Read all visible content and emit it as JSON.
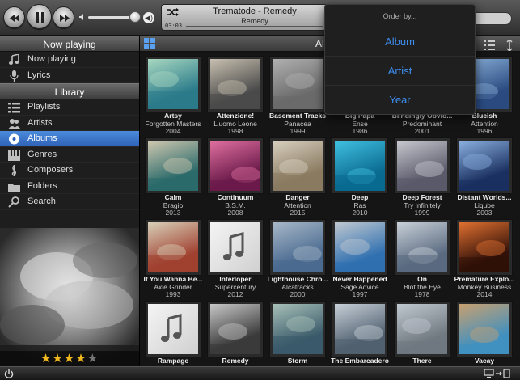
{
  "player": {
    "song": "Trematode - Remedy",
    "artist": "Remedy",
    "time": "03:03",
    "progress_fraction": 0.57
  },
  "order_by": {
    "title": "Order by...",
    "options": [
      "Album",
      "Artist",
      "Year"
    ]
  },
  "sidebar": {
    "now_playing_header": "Now playing",
    "library_header": "Library",
    "now_playing_items": [
      {
        "label": "Now playing",
        "icon": "music-note-icon"
      },
      {
        "label": "Lyrics",
        "icon": "microphone-icon"
      }
    ],
    "library_items": [
      {
        "label": "Playlists",
        "icon": "list-icon"
      },
      {
        "label": "Artists",
        "icon": "people-icon"
      },
      {
        "label": "Albums",
        "icon": "disc-icon",
        "active": true
      },
      {
        "label": "Genres",
        "icon": "piano-icon"
      },
      {
        "label": "Composers",
        "icon": "clef-icon"
      },
      {
        "label": "Folders",
        "icon": "folder-icon"
      },
      {
        "label": "Search",
        "icon": "search-icon"
      }
    ],
    "rating": 4,
    "rating_max": 5
  },
  "main": {
    "title": "All"
  },
  "albums": [
    {
      "title": "Artsy",
      "artist": "Forgotten Masters",
      "year": "2004",
      "c1": "#2a7a8a",
      "c2": "#a8d8c0"
    },
    {
      "title": "Attenzione!",
      "artist": "L'uomo Leone",
      "year": "1998",
      "c1": "#4a4a4a",
      "c2": "#c8c0b0"
    },
    {
      "title": "Basement Tracks",
      "artist": "Panacea",
      "year": "1999",
      "c1": "#6a6a6a",
      "c2": "#b0b0b0"
    },
    {
      "title": "Big Papa",
      "artist": "Ense",
      "year": "1986",
      "c1": "#333333",
      "c2": "#666666"
    },
    {
      "title": "Blindingly Obvio...",
      "artist": "Predominant",
      "year": "2001",
      "c1": "#444444",
      "c2": "#777777"
    },
    {
      "title": "Blueish",
      "artist": "Attention",
      "year": "1996",
      "c1": "#2a4a80",
      "c2": "#8ab0d8"
    },
    {
      "title": "Calm",
      "artist": "Bragio",
      "year": "2013",
      "c1": "#2a6a6a",
      "c2": "#d0c8b0"
    },
    {
      "title": "Continuum",
      "artist": "B.S.M.",
      "year": "2008",
      "c1": "#6a1a4a",
      "c2": "#e070a0"
    },
    {
      "title": "Danger",
      "artist": "Attention",
      "year": "2015",
      "c1": "#8a7a60",
      "c2": "#d8d0c0"
    },
    {
      "title": "Deep",
      "artist": "Ras",
      "year": "2010",
      "c1": "#0a6a90",
      "c2": "#40c0e0"
    },
    {
      "title": "Deep Forest",
      "artist": "Try Infinitely",
      "year": "1999",
      "c1": "#5a5a6a",
      "c2": "#c8c8d0"
    },
    {
      "title": "Distant Worlds...",
      "artist": "Liqube",
      "year": "2003",
      "c1": "#1a3060",
      "c2": "#8ab0e0"
    },
    {
      "title": "If You Wanna Be...",
      "artist": "Axle Grinder",
      "year": "1993",
      "c1": "#a04030",
      "c2": "#d8d0b8"
    },
    {
      "title": "Interloper",
      "artist": "Supercentury",
      "year": "2012",
      "c1": "#d0d0d0",
      "c2": "#f4f4f4",
      "placeholder": true
    },
    {
      "title": "Lighthouse Chro...",
      "artist": "Alcatracks",
      "year": "2000",
      "c1": "#4a6a90",
      "c2": "#a8b8c8"
    },
    {
      "title": "Never Happened",
      "artist": "Sage Advice",
      "year": "1997",
      "c1": "#3070b0",
      "c2": "#c0c8d0"
    },
    {
      "title": "On",
      "artist": "Blot the Eye",
      "year": "1978",
      "c1": "#5a6a80",
      "c2": "#c8d0d8"
    },
    {
      "title": "Premature Explo...",
      "artist": "Monkey Business",
      "year": "2014",
      "c1": "#301008",
      "c2": "#e07030"
    },
    {
      "title": "Rampage",
      "artist": "",
      "year": "",
      "c1": "#d0d0d0",
      "c2": "#f4f4f4",
      "placeholder": true
    },
    {
      "title": "Remedy",
      "artist": "",
      "year": "",
      "c1": "#3a3a3a",
      "c2": "#c8c8c8"
    },
    {
      "title": "Storm",
      "artist": "",
      "year": "",
      "c1": "#3a5a6a",
      "c2": "#a8c0b8"
    },
    {
      "title": "The Embarcadero",
      "artist": "",
      "year": "",
      "c1": "#506070",
      "c2": "#c8d0d8"
    },
    {
      "title": "There",
      "artist": "",
      "year": "",
      "c1": "#707880",
      "c2": "#c0c8d0"
    },
    {
      "title": "Vacay",
      "artist": "",
      "year": "",
      "c1": "#4090c0",
      "c2": "#c8a070"
    }
  ]
}
